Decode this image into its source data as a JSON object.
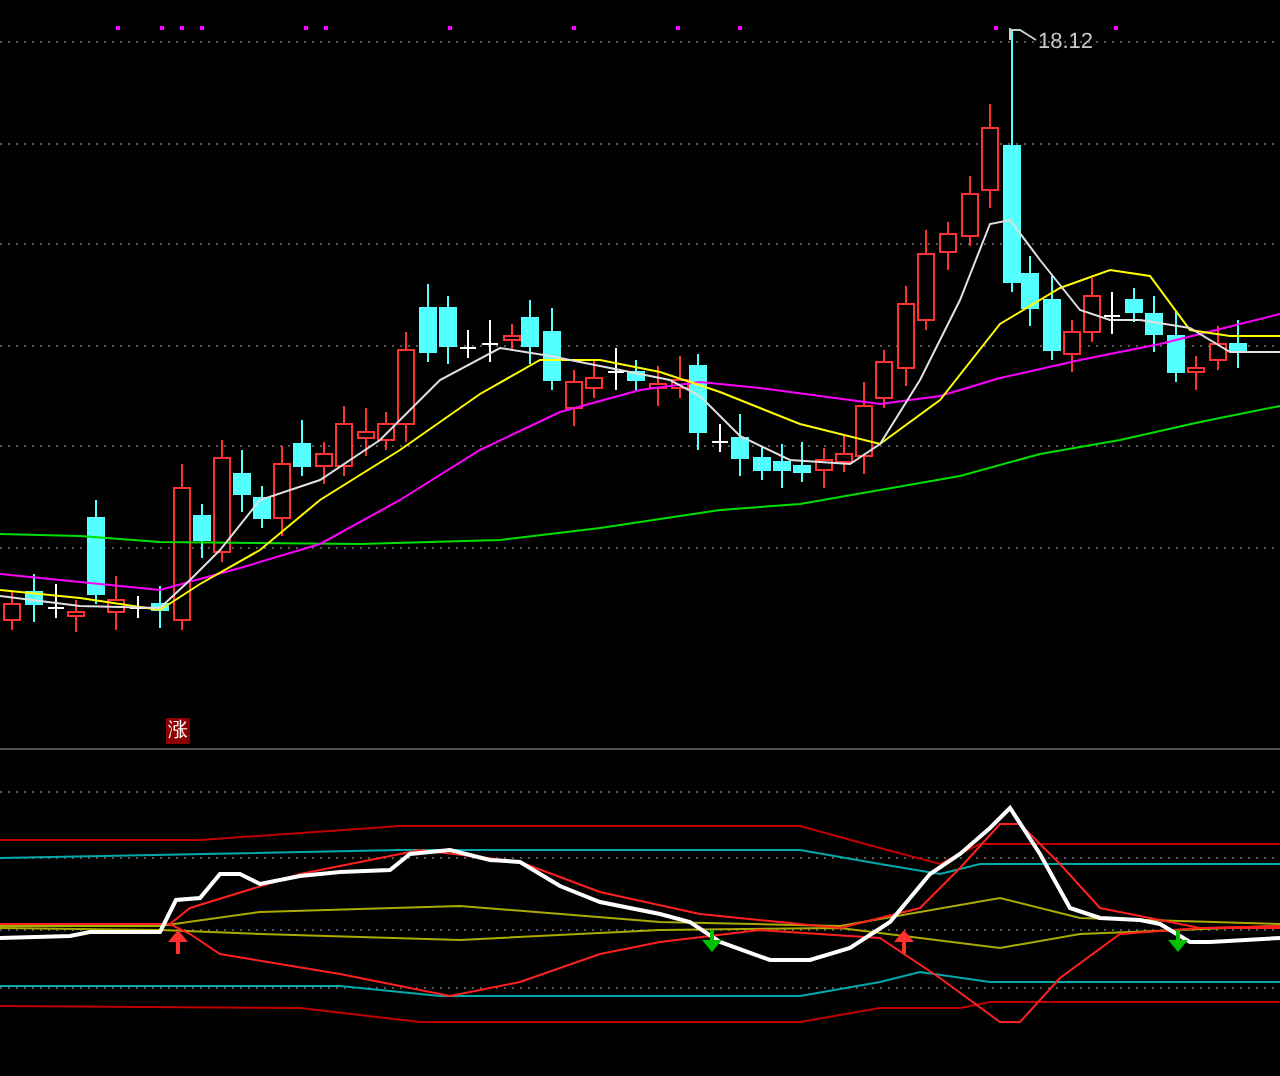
{
  "price_chart": {
    "high_label": "18.12"
  },
  "indicator": {
    "badge": "涨"
  }
}
